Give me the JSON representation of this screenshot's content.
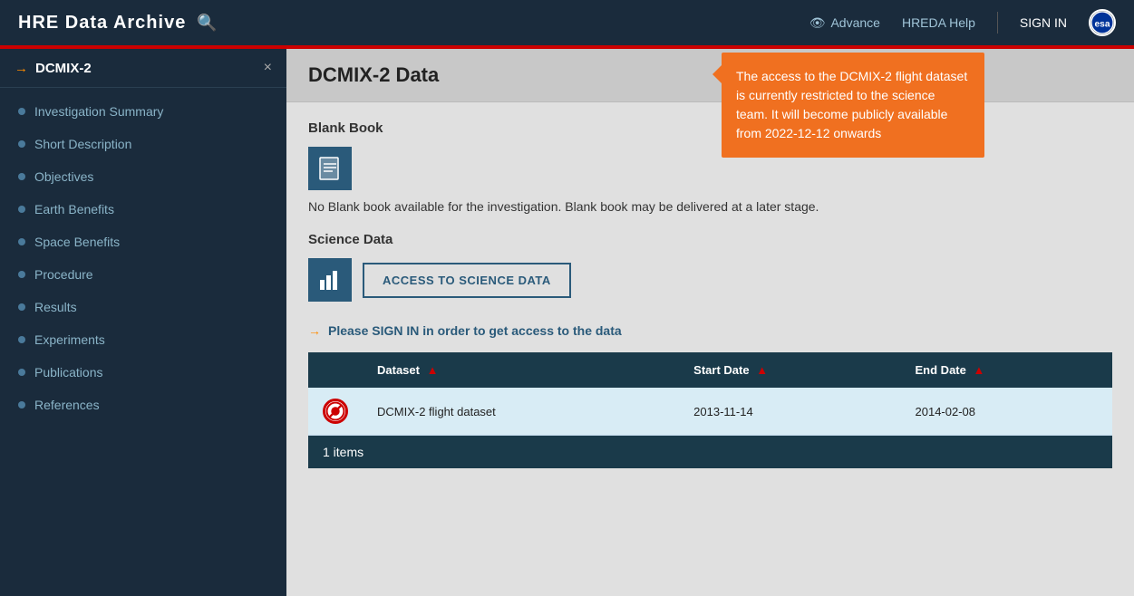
{
  "header": {
    "title": "HRE  Data Archive",
    "search_icon": "🔍",
    "nav_items": [
      {
        "label": "Advance",
        "icon": "👁"
      },
      {
        "label": "HREDA Help"
      }
    ],
    "sign_in_label": "SIGN IN",
    "esa_logo": "esa"
  },
  "sidebar": {
    "active_item": "DCMIX-2",
    "close_label": "×",
    "items": [
      {
        "label": "Investigation Summary"
      },
      {
        "label": "Short Description"
      },
      {
        "label": "Objectives"
      },
      {
        "label": "Earth Benefits"
      },
      {
        "label": "Space Benefits"
      },
      {
        "label": "Procedure"
      },
      {
        "label": "Results"
      },
      {
        "label": "Experiments"
      },
      {
        "label": "Publications"
      },
      {
        "label": "References"
      }
    ]
  },
  "main": {
    "page_title": "DCMIX-2 Data",
    "blank_book_section": {
      "label": "Blank Book",
      "icon": "📋",
      "message": "No Blank book available for the investigation. Blank book may be delivered at a later stage."
    },
    "science_data_section": {
      "label": "Science Data",
      "icon": "📊",
      "button_label": "ACCESS TO SCIENCE DATA"
    },
    "sign_in_notice": "Please SIGN IN in order to get access to the data",
    "table": {
      "columns": [
        {
          "label": "",
          "key": "icon"
        },
        {
          "label": "Dataset",
          "key": "dataset"
        },
        {
          "label": "Start Date",
          "key": "start_date"
        },
        {
          "label": "End Date",
          "key": "end_date"
        }
      ],
      "rows": [
        {
          "icon": "restricted",
          "dataset": "DCMIX-2 flight dataset",
          "start_date": "2013-11-14",
          "end_date": "2014-02-08"
        }
      ],
      "footer": "1 items"
    }
  },
  "popup": {
    "message": "The access to the DCMIX-2 flight dataset is currently restricted to the science team. It will become publicly available from 2022-12-12 onwards"
  }
}
